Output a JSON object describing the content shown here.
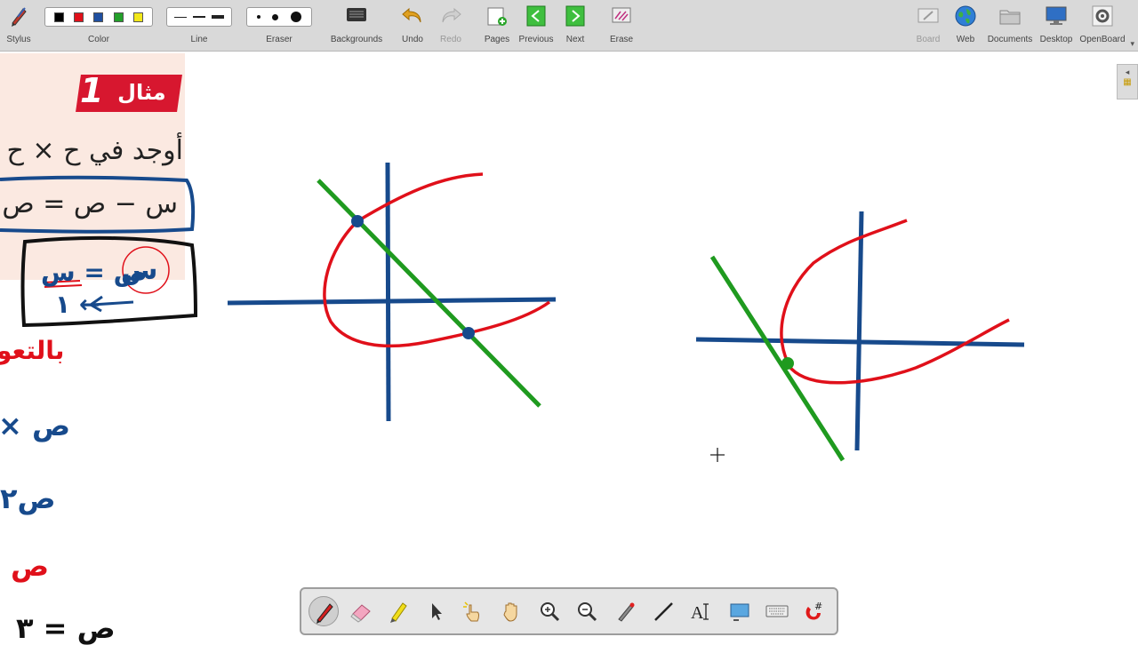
{
  "toolbar": {
    "stylus": "Stylus",
    "color": "Color",
    "line": "Line",
    "eraser": "Eraser",
    "backgrounds": "Backgrounds",
    "undo": "Undo",
    "redo": "Redo",
    "pages": "Pages",
    "previous": "Previous",
    "next": "Next",
    "erase": "Erase",
    "board": "Board",
    "web": "Web",
    "documents": "Documents",
    "desktop": "Desktop",
    "openboard": "OpenBoard"
  },
  "colors": {
    "swatches": [
      "#000000",
      "#e0101a",
      "#1f4fa0",
      "#23a02a",
      "#f2e81a"
    ],
    "pen_red": "#e0101a",
    "pen_blue": "#174a8c",
    "pen_green": "#1f9a1f",
    "badge_red": "#d7172f"
  },
  "page_image": {
    "badge_text": "مثال",
    "badge_number": "1",
    "question": "أوجد في ح × ح",
    "equation": "س − ص = ص"
  },
  "handwriting": {
    "boxed_top": "ص = س",
    "boxed_bottom": "١ ←",
    "substitution": "بالتعو",
    "line1": "× ص",
    "line2": "ص٢",
    "line3": "ص",
    "line4": "ص = ٣"
  },
  "bottom_tools": [
    "pen-tool",
    "eraser-tool",
    "highlighter-tool",
    "select-tool",
    "interact-tool",
    "hand-tool",
    "zoom-in-tool",
    "zoom-out-tool",
    "laser-pointer-tool",
    "line-tool",
    "text-tool",
    "capture-tool",
    "keyboard-tool",
    "widget-tool"
  ]
}
